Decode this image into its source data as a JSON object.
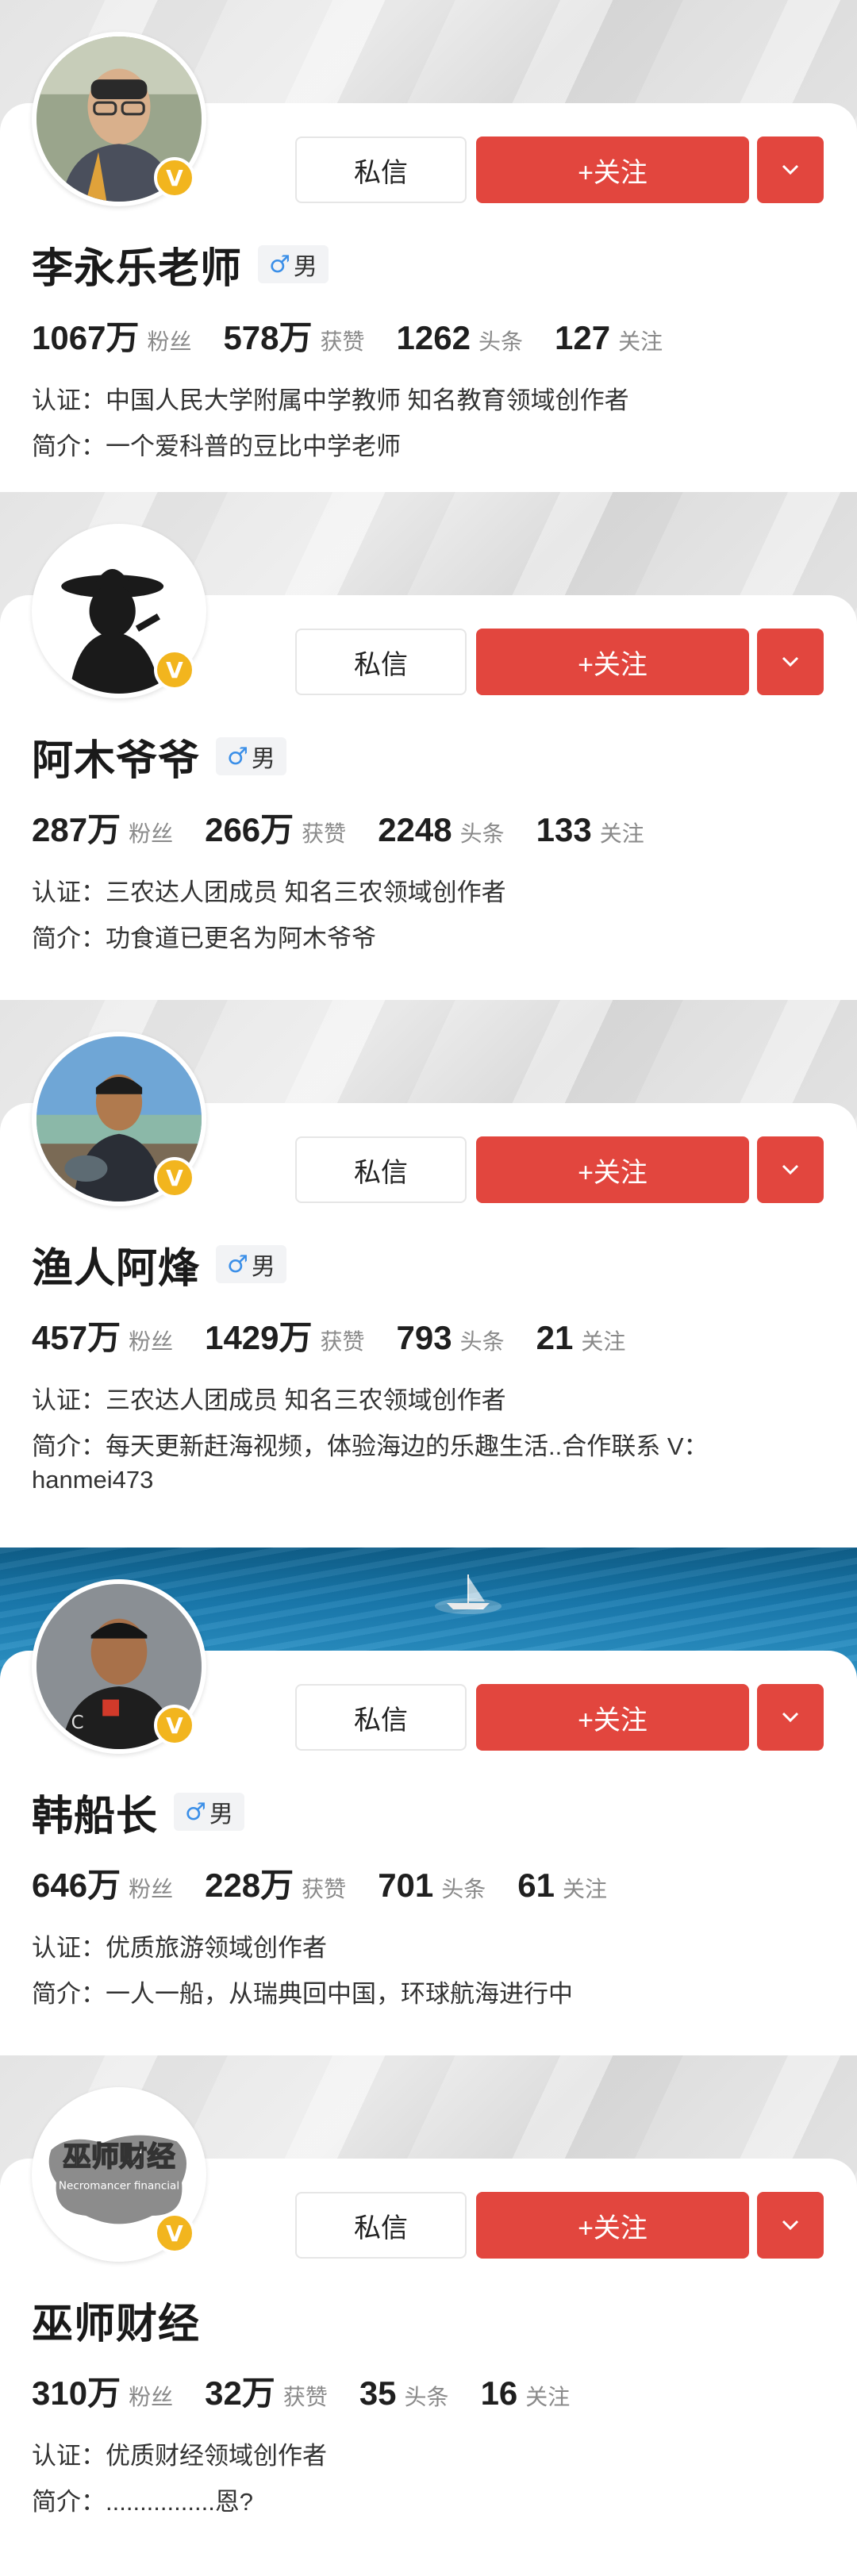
{
  "buttons": {
    "message": "私信",
    "follow": "+关注",
    "more_icon": "chevron-down-icon"
  },
  "badge": {
    "verified_icon": "v-badge-icon",
    "verified_text": "V",
    "color": "#f2b51e"
  },
  "colors": {
    "accent": "#e2463e",
    "male": "#3b8fe8"
  },
  "labels": {
    "fans": "粉丝",
    "likes": "获赞",
    "posts": "头条",
    "following": "关注",
    "cert_prefix": "认证：",
    "intro_prefix": "简介："
  },
  "profiles": [
    {
      "name": "李永乐老师",
      "gender_symbol": "♂",
      "gender": "男",
      "stats": {
        "fans": "1067万",
        "likes": "578万",
        "posts": "1262",
        "following": "127"
      },
      "cert": "中国人民大学附属中学教师 知名教育领域创作者",
      "intro": "一个爱科普的豆比中学老师",
      "cover": "gray"
    },
    {
      "name": "阿木爷爷",
      "gender_symbol": "♂",
      "gender": "男",
      "stats": {
        "fans": "287万",
        "likes": "266万",
        "posts": "2248",
        "following": "133"
      },
      "cert": "三农达人团成员 知名三农领域创作者",
      "intro": "功食道已更名为阿木爷爷",
      "cover": "gray"
    },
    {
      "name": "渔人阿烽",
      "gender_symbol": "♂",
      "gender": "男",
      "stats": {
        "fans": "457万",
        "likes": "1429万",
        "posts": "793",
        "following": "21"
      },
      "cert": "三农达人团成员 知名三农领域创作者",
      "intro": "每天更新赶海视频，体验海边的乐趣生活..合作联系 V：hanmei473",
      "cover": "gray"
    },
    {
      "name": "韩船长",
      "gender_symbol": "♂",
      "gender": "男",
      "stats": {
        "fans": "646万",
        "likes": "228万",
        "posts": "701",
        "following": "61"
      },
      "cert": "优质旅游领域创作者",
      "intro": "一人一船，从瑞典回中国，环球航海进行中",
      "cover": "sea"
    },
    {
      "name": "巫师财经",
      "logo_text": "巫师财经",
      "logo_subtext": "Necromancer financial",
      "stats": {
        "fans": "310万",
        "likes": "32万",
        "posts": "35",
        "following": "16"
      },
      "cert": "优质财经领域创作者",
      "intro": "................恩?",
      "cover": "gray"
    }
  ]
}
